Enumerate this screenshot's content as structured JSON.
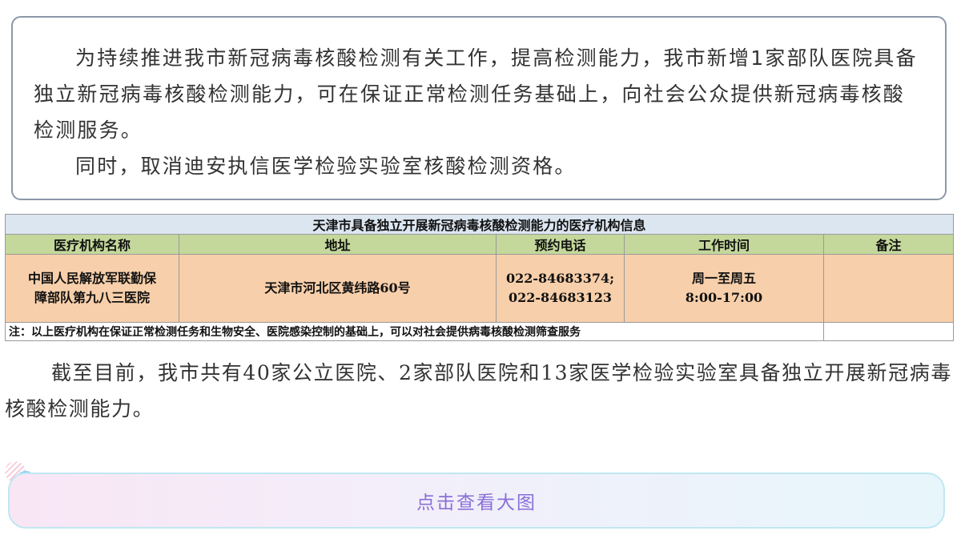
{
  "notice": {
    "paragraph1": "为持续推进我市新冠病毒核酸检测有关工作，提高检测能力，我市新增1家部队医院具备独立新冠病毒核酸检测能力，可在保证正常检测任务基础上，向社会公众提供新冠病毒核酸检测服务。",
    "paragraph2": "同时，取消迪安执信医学检验实验室核酸检测资格。"
  },
  "table": {
    "title": "天津市具备独立开展新冠病毒核酸检测能力的医疗机构信息",
    "headers": [
      "医疗机构名称",
      "地址",
      "预约电话",
      "工作时间",
      "备注"
    ],
    "row": {
      "name_line1": "中国人民解放军联勤保",
      "name_line2": "障部队第九八三医院",
      "address": "天津市河北区黄纬路60号",
      "phone_line1": "022-84683374;",
      "phone_line2": "022-84683123",
      "hours_line1": "周一至周五",
      "hours_line2": "8:00-17:00",
      "remark": ""
    },
    "note": "注：以上医疗机构在保证正常检测任务和生物安全、医院感染控制的基础上，可以对社会提供病毒核酸检测筛查服务"
  },
  "summary": "截至目前，我市共有40家公立医院、2家部队医院和13家医学检验实验室具备独立开展新冠病毒核酸检测能力。",
  "view_more": {
    "label": "点击查看大图"
  }
}
